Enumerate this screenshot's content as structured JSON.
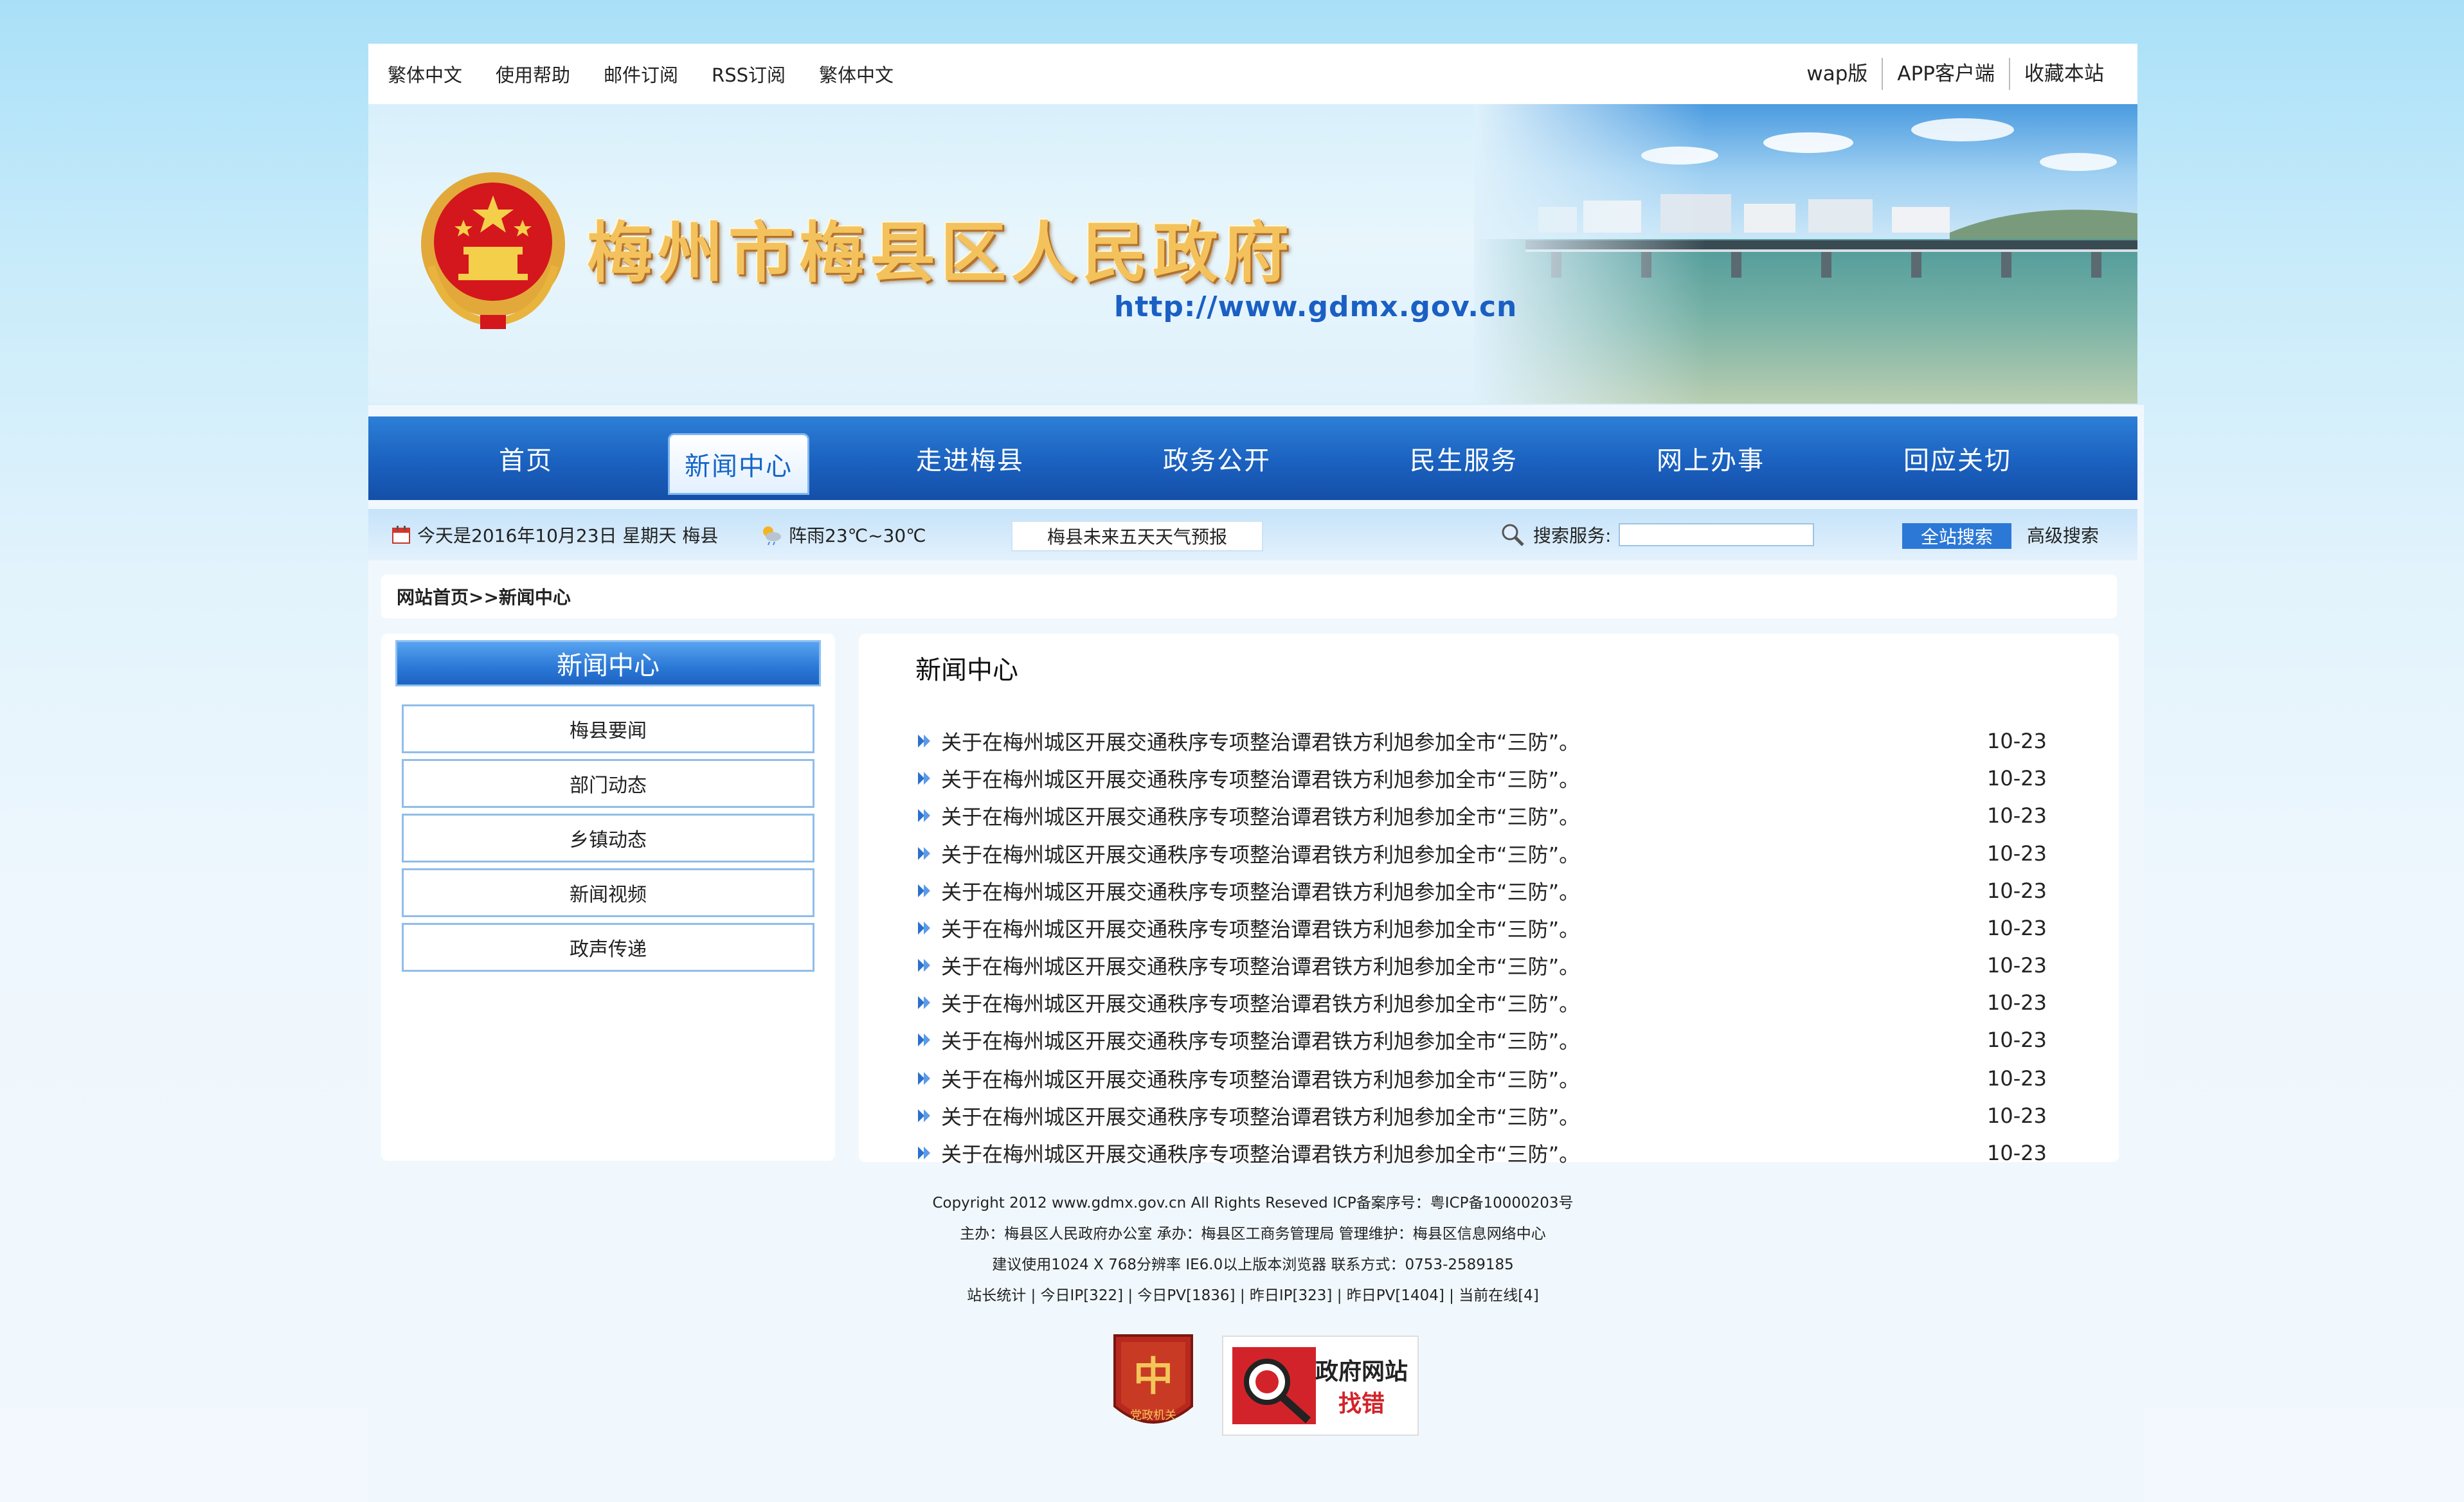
{
  "topbar": {
    "left_links": [
      "繁体中文",
      "使用帮助",
      "邮件订阅",
      "RSS订阅",
      "繁体中文"
    ],
    "right_links": [
      "wap版",
      "APP客户端",
      "收藏本站"
    ]
  },
  "banner": {
    "title": "梅州市梅县区人民政府",
    "url": "http://www.gdmx.gov.cn"
  },
  "nav": {
    "items": [
      "首页",
      "新闻中心",
      "走进梅县",
      "政务公开",
      "民生服务",
      "网上办事",
      "回应关切"
    ],
    "active": "新闻中心"
  },
  "infobar": {
    "date": "今天是2016年10月23日 星期天 梅县",
    "weather": "阵雨23℃~30℃",
    "forecast_button": "梅县未来五天天气预报",
    "search_label": "搜索服务:",
    "search_value": "",
    "search_button": "全站搜索",
    "advanced_search": "高级搜索"
  },
  "breadcrumb": "网站首页>>新闻中心",
  "sidebar": {
    "title": "新闻中心",
    "items": [
      "梅县要闻",
      "部门动态",
      "乡镇动态",
      "新闻视频",
      "政声传递"
    ]
  },
  "content": {
    "title": "新闻中心",
    "news": [
      {
        "title": "关于在梅州城区开展交通秩序专项整治谭君铁方利旭参加全市“三防”。",
        "date": "10-23"
      },
      {
        "title": "关于在梅州城区开展交通秩序专项整治谭君铁方利旭参加全市“三防”。",
        "date": "10-23"
      },
      {
        "title": "关于在梅州城区开展交通秩序专项整治谭君铁方利旭参加全市“三防”。",
        "date": "10-23"
      },
      {
        "title": "关于在梅州城区开展交通秩序专项整治谭君铁方利旭参加全市“三防”。",
        "date": "10-23"
      },
      {
        "title": "关于在梅州城区开展交通秩序专项整治谭君铁方利旭参加全市“三防”。",
        "date": "10-23"
      },
      {
        "title": "关于在梅州城区开展交通秩序专项整治谭君铁方利旭参加全市“三防”。",
        "date": "10-23"
      },
      {
        "title": "关于在梅州城区开展交通秩序专项整治谭君铁方利旭参加全市“三防”。",
        "date": "10-23"
      },
      {
        "title": "关于在梅州城区开展交通秩序专项整治谭君铁方利旭参加全市“三防”。",
        "date": "10-23"
      },
      {
        "title": "关于在梅州城区开展交通秩序专项整治谭君铁方利旭参加全市“三防”。",
        "date": "10-23"
      },
      {
        "title": "关于在梅州城区开展交通秩序专项整治谭君铁方利旭参加全市“三防”。",
        "date": "10-23"
      },
      {
        "title": "关于在梅州城区开展交通秩序专项整治谭君铁方利旭参加全市“三防”。",
        "date": "10-23"
      },
      {
        "title": "关于在梅州城区开展交通秩序专项整治谭君铁方利旭参加全市“三防”。",
        "date": "10-23"
      }
    ]
  },
  "footer": {
    "line1": "Copyright  2012     www.gdmx.gov.cn  All Rights Reseved    ICP备案序号：粤ICP备10000203号",
    "line2": "主办：梅县区人民政府办公室          承办：梅县区工商务管理局        管理维护：梅县区信息网络中心",
    "line3": "建议使用1024 X 768分辨率 IE6.0以上版本浏览器    联系方式：0753-2589185",
    "line4": "站长统计 | 今日IP[322] | 今日PV[1836] | 昨日IP[323] | 昨日PV[1404] | 当前在线[4]",
    "badge_party": "党政机关",
    "badge_error_line1": "政府网站",
    "badge_error_line2": "找错"
  },
  "colors": {
    "nav_blue": "#1b61bf",
    "accent_blue": "#2b78d6",
    "title_gold": "#f3c25c",
    "emblem_red": "#d4161d"
  }
}
